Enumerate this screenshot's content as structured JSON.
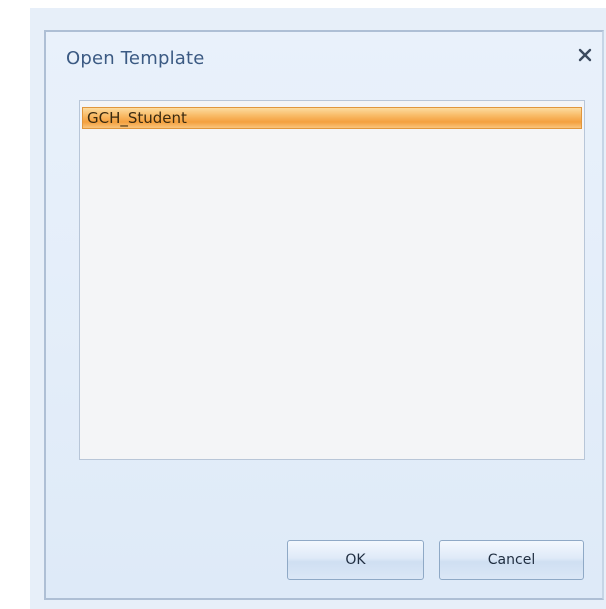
{
  "dialog": {
    "title": "Open Template",
    "close_icon": "close-icon"
  },
  "templates": {
    "items": [
      {
        "label": "GCH_Student",
        "selected": true
      }
    ]
  },
  "buttons": {
    "ok_label": "OK",
    "cancel_label": "Cancel"
  },
  "colors": {
    "selection": "#f4a03e",
    "title_text": "#3b5a83"
  }
}
